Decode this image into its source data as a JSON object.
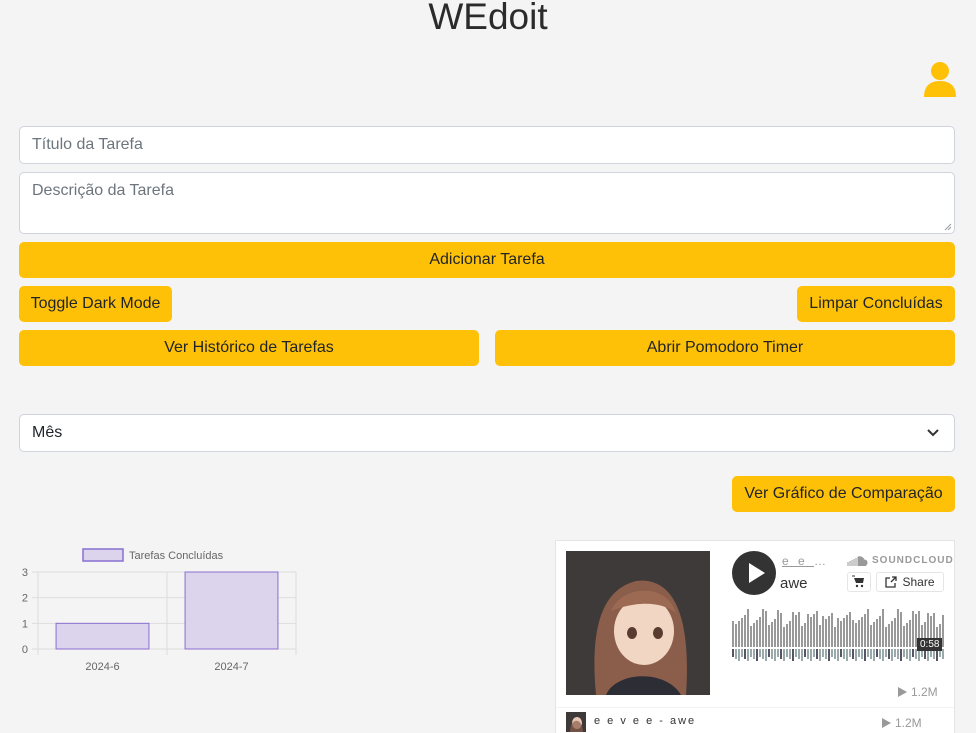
{
  "app": {
    "title": "WEdoit"
  },
  "form": {
    "title_placeholder": "Título da Tarefa",
    "description_placeholder": "Descrição da Tarefa",
    "add_label": "Adicionar Tarefa"
  },
  "actions": {
    "dark_mode_label": "Toggle Dark Mode",
    "clear_label": "Limpar Concluídas",
    "history_label": "Ver Histórico de Tarefas",
    "pomodoro_label": "Abrir Pomodoro Timer",
    "compare_label": "Ver Gráfico de Comparação"
  },
  "filter": {
    "selected": "Mês"
  },
  "chart_data": {
    "type": "bar",
    "categories": [
      "2024-6",
      "2024-7"
    ],
    "series": [
      {
        "name": "Tarefas Concluídas",
        "values": [
          1,
          3
        ]
      }
    ],
    "yticks": [
      "0",
      "1",
      "2",
      "3"
    ],
    "ylim": [
      0,
      3
    ],
    "legend": "top",
    "grid": true,
    "colors": {
      "fill": "#dcd3ec",
      "stroke": "#8a6fd1"
    }
  },
  "soundcloud": {
    "user": "e e v e e",
    "track": "awe",
    "brand": "SOUNDCLOUD",
    "share_label": "Share",
    "duration": "0:58",
    "plays": "1.2M",
    "list_title": "e e v e e - awe",
    "list_plays": "1.2M"
  },
  "colors": {
    "accent": "#ffc107",
    "background": "#f4f4f4"
  }
}
